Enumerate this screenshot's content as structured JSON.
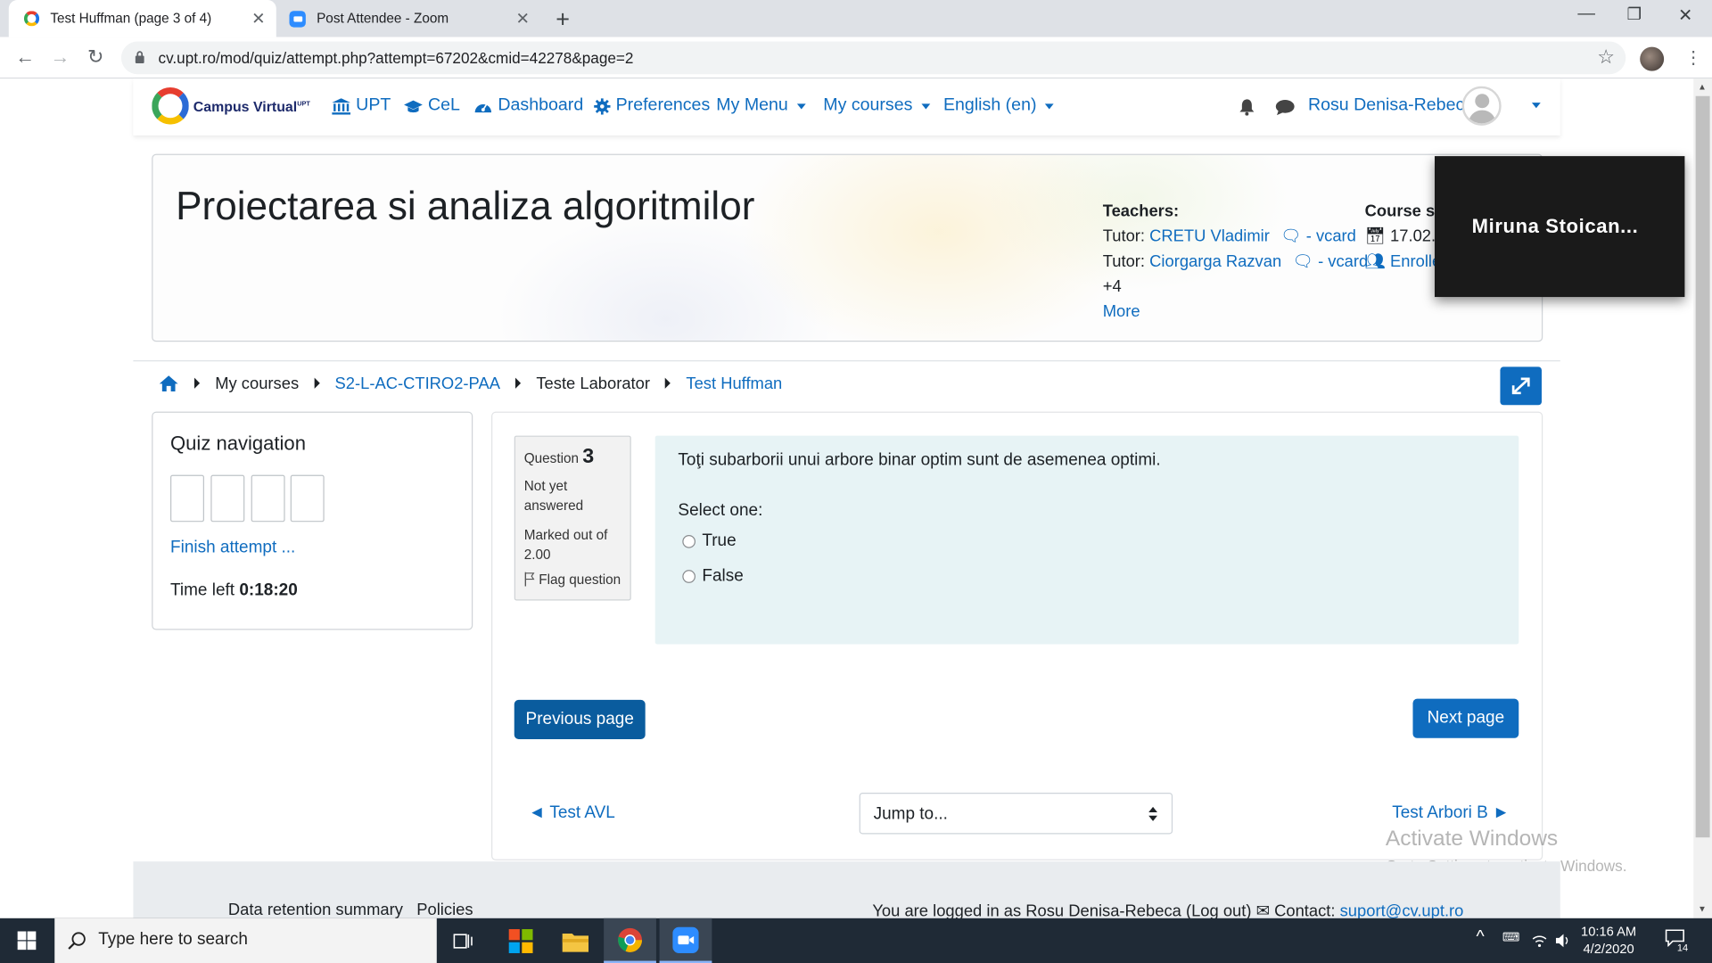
{
  "browser": {
    "tabs": [
      {
        "title": "Test Huffman (page 3 of 4)",
        "active": true
      },
      {
        "title": "Post Attendee - Zoom",
        "active": false
      }
    ],
    "url": "cv.upt.ro/mod/quiz/attempt.php?attempt=67202&cmid=42278&page=2"
  },
  "navbar": {
    "logo_text": "Campus Virtual",
    "logo_sup": "UPT",
    "items": [
      "UPT",
      "CeL",
      "Dashboard",
      "Preferences",
      "My Menu",
      "My courses",
      "English (en)"
    ],
    "user_name": "Rosu Denisa-Rebeca"
  },
  "course_header": {
    "title": "Proiectarea si analiza algoritmilor",
    "teachers_heading": "Teachers:",
    "tutor_label": "Tutor:",
    "tutors": [
      "CRETU Vladimir",
      "Ciorgarga Razvan"
    ],
    "vcard": "- vcard",
    "more_count": "+4",
    "more_link": "More",
    "course_start_heading": "Course st",
    "start_date": "17.02.2",
    "enrolled": "Enrolle"
  },
  "zoom_tile": {
    "name": "Miruna Stoican..."
  },
  "breadcrumb": [
    "My courses",
    "S2-L-AC-CTIRO2-PAA",
    "Teste Laborator",
    "Test Huffman"
  ],
  "quiz_nav": {
    "heading": "Quiz navigation",
    "finish": "Finish attempt ...",
    "time_label": "Time left",
    "time_value": "0:18:20"
  },
  "question": {
    "label": "Question",
    "number": "3",
    "state": "Not yet answered",
    "grade": "Marked out of 2.00",
    "flag": "Flag question",
    "text": "Toţi subarborii unui arbore binar optim sunt de asemenea optimi.",
    "prompt": "Select one:",
    "options": [
      "True",
      "False"
    ]
  },
  "buttons": {
    "previous": "Previous page",
    "next": "Next page"
  },
  "activity_nav": {
    "prev": "◄ Test AVL",
    "jump": "Jump to...",
    "next": "Test Arbori B ►"
  },
  "watermark": {
    "line1": "Activate Windows",
    "line2": "Go to Settings to activate Windows."
  },
  "footer": {
    "left1": "Data retention summary",
    "left2": "Policies",
    "logged_in": "You are logged in as Rosu Denisa-Rebeca (Log out)",
    "contact_label": "Contact:",
    "contact_email": "suport@cv.upt.ro"
  },
  "taskbar": {
    "search_placeholder": "Type here to search",
    "time": "10:16 AM",
    "date": "4/2/2020",
    "notifications": "14"
  },
  "colors": {
    "link": "#0f6cbf",
    "primary_button": "#0f6cbf",
    "question_bg": "#e7f3f5",
    "taskbar": "#1f2a36"
  }
}
